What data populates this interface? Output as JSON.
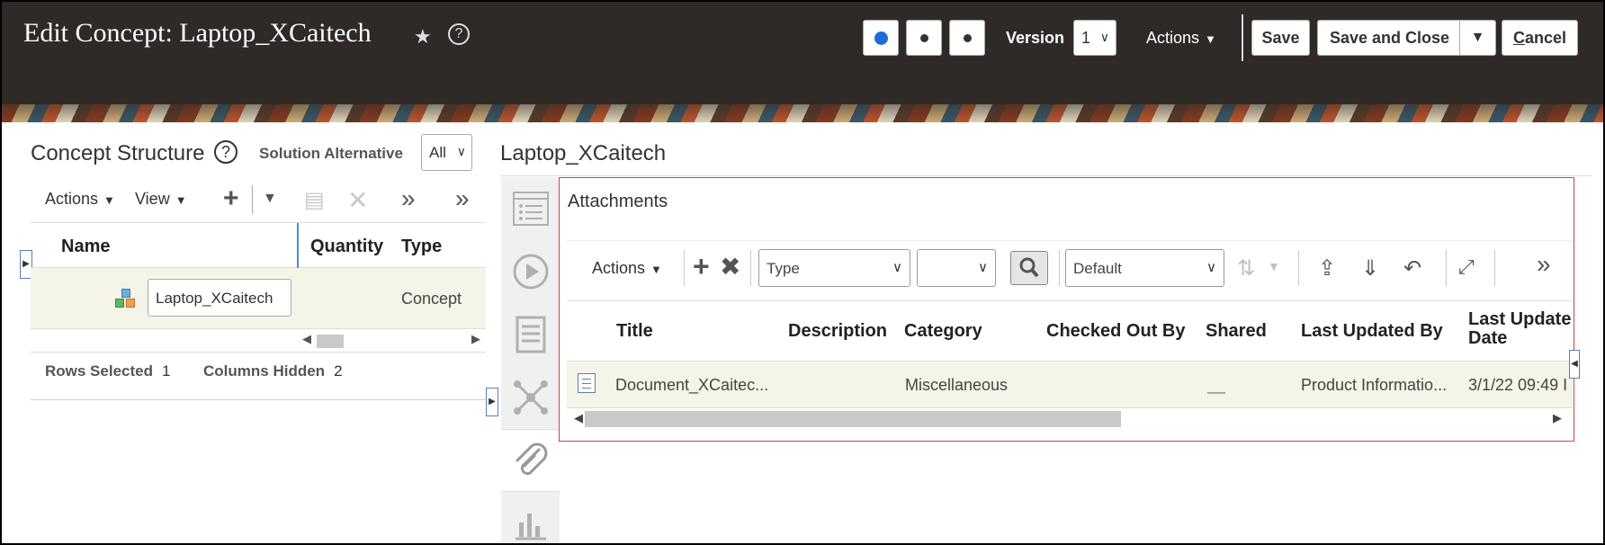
{
  "header": {
    "title": "Edit Concept: Laptop_XCaitech",
    "version_label": "Version",
    "version_value": "1",
    "actions_label": "Actions",
    "save_label": "Save",
    "save_close_label": "Save and Close",
    "cancel_label": "Cancel",
    "progress_dots": 3,
    "active_dot": 1
  },
  "concept_structure": {
    "title": "Concept Structure",
    "solution_alternative_label": "Solution Alternative",
    "solution_alternative_value": "All",
    "toolbar": {
      "actions_label": "Actions",
      "view_label": "View"
    },
    "columns": [
      "Name",
      "Quantity",
      "Type"
    ],
    "rows": [
      {
        "name": "Laptop_XCaitech",
        "quantity": "",
        "type": "Concept"
      }
    ],
    "status": {
      "rows_selected_label": "Rows Selected",
      "rows_selected_value": "1",
      "columns_hidden_label": "Columns Hidden",
      "columns_hidden_value": "2"
    }
  },
  "detail": {
    "title": "Laptop_XCaitech",
    "side_tabs": [
      "list-icon",
      "play-icon",
      "document-icon",
      "network-icon",
      "paperclip-icon",
      "bar-chart-icon"
    ],
    "active_tab": "paperclip-icon"
  },
  "attachments": {
    "title": "Attachments",
    "toolbar": {
      "actions_label": "Actions",
      "type_select": "Type",
      "second_select": "",
      "view_select": "Default"
    },
    "columns": [
      "Title",
      "Description",
      "Category",
      "Checked Out By",
      "Shared",
      "Last Updated By",
      "Last Update Date"
    ],
    "rows": [
      {
        "title": "Document_XCaitec...",
        "description": "",
        "category": "Miscellaneous",
        "checked_out_by": "",
        "shared": "__",
        "last_updated_by": "Product Informatio...",
        "last_update_date": "3/1/22 09:49 I"
      }
    ]
  },
  "colors": {
    "header_bg": "#2f2a27",
    "accent_blue": "#1c6fd6",
    "highlight_border": "#e03c3c",
    "selected_row": "#f4f4e8"
  }
}
